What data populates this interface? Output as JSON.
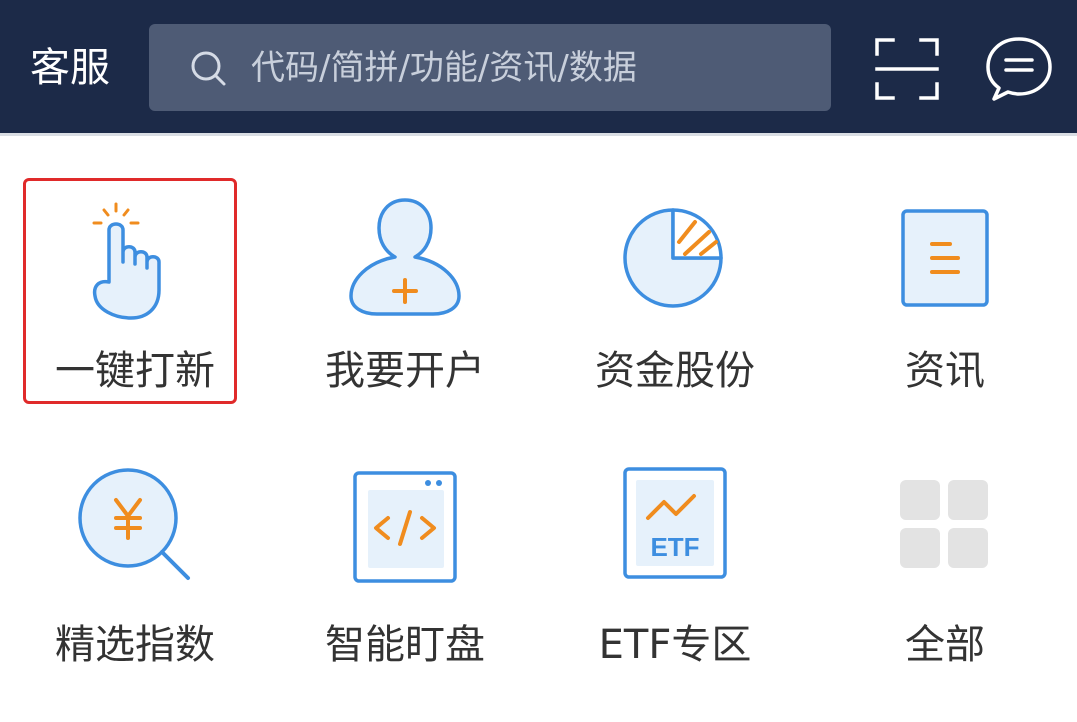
{
  "header": {
    "service_label": "客服",
    "search": {
      "placeholder": "代码/简拼/功能/资讯/数据"
    }
  },
  "grid": [
    {
      "label": "一键打新",
      "icon": "tap-finger-icon",
      "highlighted": true
    },
    {
      "label": "我要开户",
      "icon": "user-add-icon"
    },
    {
      "label": "资金股份",
      "icon": "pie-chart-icon"
    },
    {
      "label": "资讯",
      "icon": "document-icon"
    },
    {
      "label": "精选指数",
      "icon": "yuan-search-icon"
    },
    {
      "label": "智能盯盘",
      "icon": "code-window-icon"
    },
    {
      "label": "ETF专区",
      "icon": "etf-chart-icon",
      "icon_text": "ETF"
    },
    {
      "label": "全部",
      "icon": "grid-all-icon"
    }
  ],
  "colors": {
    "header_bg": "#1c2a48",
    "search_bg": "#4e5b75",
    "icon_blue": "#3d8ee0",
    "icon_fill": "#e6f1fb",
    "icon_orange": "#f08c1e",
    "highlight_border": "#e02a2a",
    "label_text": "#333333"
  }
}
